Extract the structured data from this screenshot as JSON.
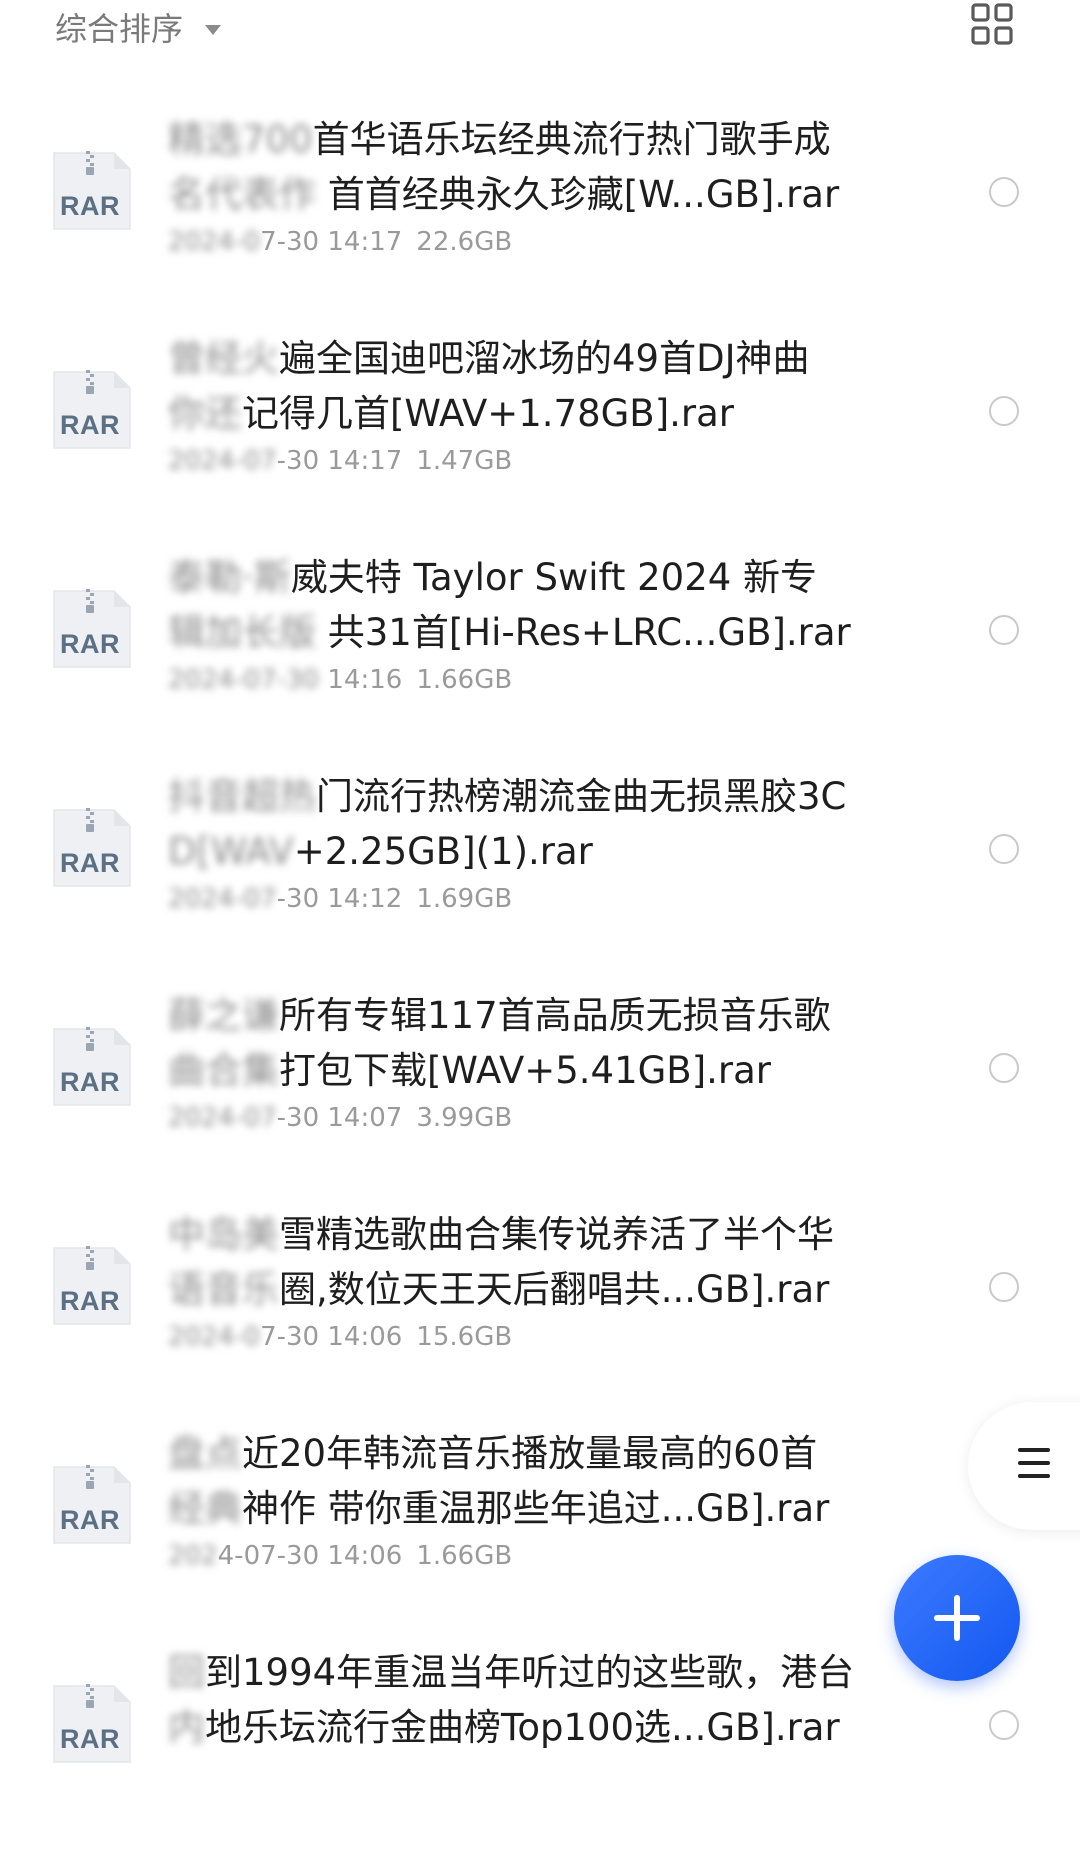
{
  "toolbar": {
    "sort_label": "综合排序",
    "sort_icon": "caret-down-icon",
    "view_icon": "grid-view-icon"
  },
  "files": [
    {
      "type": "RAR",
      "title_blur1": "精选700",
      "title_rest1": "首华语乐坛经典流行热门歌手成",
      "title_blur2": "名代表作",
      "title_rest2": " 首首经典永久珍藏[W...GB].rar",
      "date_blur": "2024-0",
      "date_rest": "7-30 14:17",
      "size": "22.6GB"
    },
    {
      "type": "RAR",
      "title_blur1": "曾经火",
      "title_rest1": "遍全国迪吧溜冰场的49首DJ神曲",
      "title_blur2": "你还",
      "title_rest2": "记得几首[WAV+1.78GB].rar",
      "date_blur": "2024-07",
      "date_rest": "-30 14:17",
      "size": "1.47GB"
    },
    {
      "type": "RAR",
      "title_blur1": "泰勒·斯",
      "title_rest1": "威夫特 Taylor Swift 2024 新专",
      "title_blur2": "辑加长版",
      "title_rest2": " 共31首[Hi-Res+LRC...GB].rar",
      "date_blur": "2024-07-30",
      "date_rest": " 14:16",
      "size": "1.66GB"
    },
    {
      "type": "RAR",
      "title_blur1": "抖音超热",
      "title_rest1": "门流行热榜潮流金曲无损黑胶3C",
      "title_blur2": "D[WAV",
      "title_rest2": "+2.25GB](1).rar",
      "date_blur": "2024-07",
      "date_rest": "-30 14:12",
      "size": "1.69GB"
    },
    {
      "type": "RAR",
      "title_blur1": "薛之谦",
      "title_rest1": "所有专辑117首高品质无损音乐歌",
      "title_blur2": "曲合集",
      "title_rest2": "打包下载[WAV+5.41GB].rar",
      "date_blur": "2024-07",
      "date_rest": "-30 14:07",
      "size": "3.99GB"
    },
    {
      "type": "RAR",
      "title_blur1": "中岛美",
      "title_rest1": "雪精选歌曲合集传说养活了半个华",
      "title_blur2": "语音乐",
      "title_rest2": "圈,数位天王天后翻唱共...GB].rar",
      "date_blur": "2024-0",
      "date_rest": "7-30 14:06",
      "size": "15.6GB"
    },
    {
      "type": "RAR",
      "title_blur1": "盘点",
      "title_rest1": "近20年韩流音乐播放量最高的60首",
      "title_blur2": "经典",
      "title_rest2": "神作 带你重温那些年追过...GB].rar",
      "date_blur": "202",
      "date_rest": "4-07-30 14:06",
      "size": "1.66GB"
    },
    {
      "type": "RAR",
      "title_blur1": "回",
      "title_rest1": "到1994年重温当年听过的这些歌，港台",
      "title_blur2": "内",
      "title_rest2": "地乐坛流行金曲榜Top100选...GB].rar",
      "date_blur": "",
      "date_rest": "",
      "size": ""
    }
  ],
  "side_menu": {
    "icon": "menu-icon"
  },
  "fab": {
    "icon": "plus-icon"
  }
}
